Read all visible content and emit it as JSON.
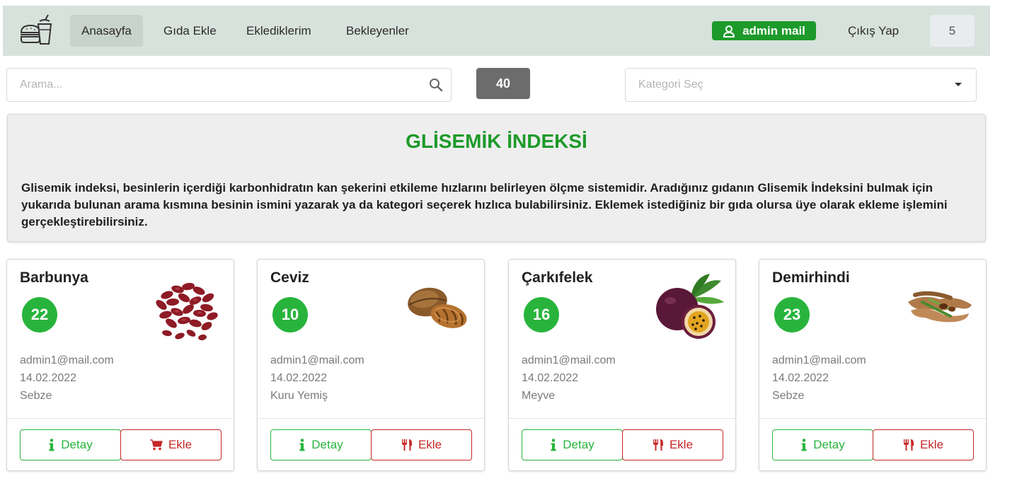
{
  "navbar": {
    "logo_icon": "fast-food-icon",
    "items": [
      {
        "label": "Anasayfa",
        "active": true
      },
      {
        "label": "Gıda Ekle",
        "active": false
      },
      {
        "label": "Eklediklerim",
        "active": false
      },
      {
        "label": "Bekleyenler",
        "active": false
      }
    ],
    "user": {
      "label": "admin mail",
      "icon": "user-icon",
      "color": "#1d9a2a"
    },
    "logout_label": "Çıkış Yap",
    "count": "5"
  },
  "search": {
    "placeholder": "Arama...",
    "icon": "search-icon",
    "total": "40",
    "category_placeholder": "Kategori Seç"
  },
  "info": {
    "title": "GLİSEMİK İNDEKSİ",
    "text": "Glisemik indeksi, besinlerin içerdiği karbonhidratın kan şekerini etkileme hızlarını belirleyen ölçme sistemidir. Aradığınız gıdanın Glisemik İndeksini bulmak için yukarıda bulunan arama kısmına besinin ismini yazarak ya da kategori seçerek hızlıca bulabilirsiniz. Eklemek istediğiniz bir gıda olursa üye olarak ekleme işlemini gerçekleştirebilirsiniz.",
    "title_color": "#1d9a2a"
  },
  "cards": [
    {
      "name": "Barbunya",
      "gi": "22",
      "email": "admin1@mail.com",
      "date": "14.02.2022",
      "category": "Sebze",
      "image": "kidney-beans-image",
      "detail_label": "Detay",
      "add_label": "Ekle",
      "add_icon": "cart-icon"
    },
    {
      "name": "Ceviz",
      "gi": "10",
      "email": "admin1@mail.com",
      "date": "14.02.2022",
      "category": "Kuru Yemiş",
      "image": "walnut-image",
      "detail_label": "Detay",
      "add_label": "Ekle",
      "add_icon": "utensils-icon"
    },
    {
      "name": "Çarkıfelek",
      "gi": "16",
      "email": "admin1@mail.com",
      "date": "14.02.2022",
      "category": "Meyve",
      "image": "passion-fruit-image",
      "detail_label": "Detay",
      "add_label": "Ekle",
      "add_icon": "utensils-icon"
    },
    {
      "name": "Demirhindi",
      "gi": "23",
      "email": "admin1@mail.com",
      "date": "14.02.2022",
      "category": "Sebze",
      "image": "tamarind-image",
      "detail_label": "Detay",
      "add_label": "Ekle",
      "add_icon": "utensils-icon"
    }
  ],
  "colors": {
    "green": "#28b43c",
    "red": "#c62828",
    "navbar": "#d8e2dc"
  }
}
